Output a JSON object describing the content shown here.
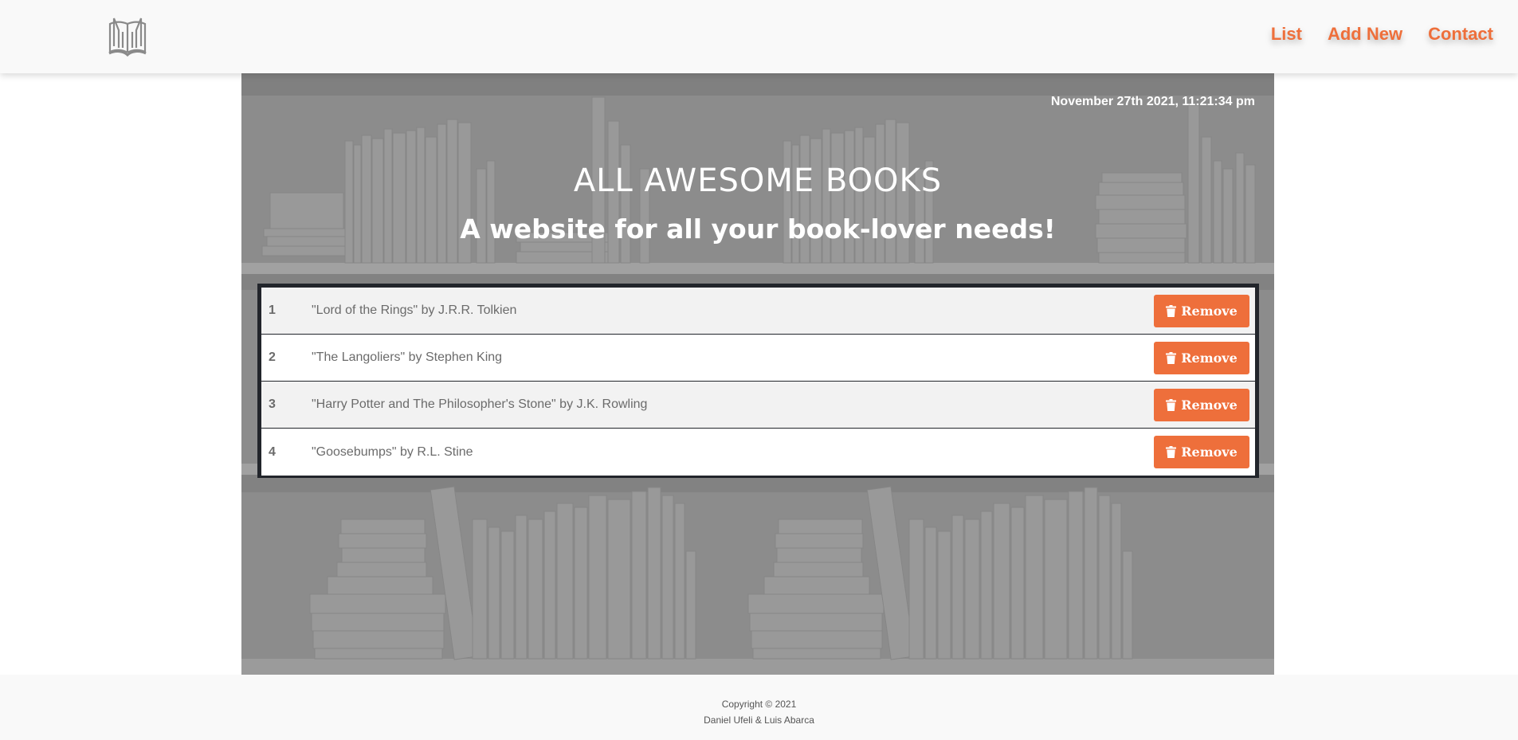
{
  "header": {
    "nav": [
      "List",
      "Add New",
      "Contact"
    ],
    "accent_color": "#ee6f3b"
  },
  "hero": {
    "datetime": "November 27th 2021, 11:21:34 pm",
    "title": "ALL AWESOME BOOKS",
    "subtitle": "A website for all your book-lover needs!"
  },
  "books": [
    {
      "num": "1",
      "text": "\"Lord of the Rings\" by J.R.R. Tolkien",
      "button": "Remove"
    },
    {
      "num": "2",
      "text": "\"The Langoliers\" by Stephen King",
      "button": "Remove"
    },
    {
      "num": "3",
      "text": "\"Harry Potter and The Philosopher's Stone\" by J.K. Rowling",
      "button": "Remove"
    },
    {
      "num": "4",
      "text": "\"Goosebumps\" by R.L. Stine",
      "button": "Remove"
    }
  ],
  "icons": {
    "logo": "open-book-icon",
    "remove": "trash-icon"
  },
  "footer": {
    "copyright": "Copyright © 2021",
    "authors": "Daniel Ufeli & Luis Abarca"
  }
}
